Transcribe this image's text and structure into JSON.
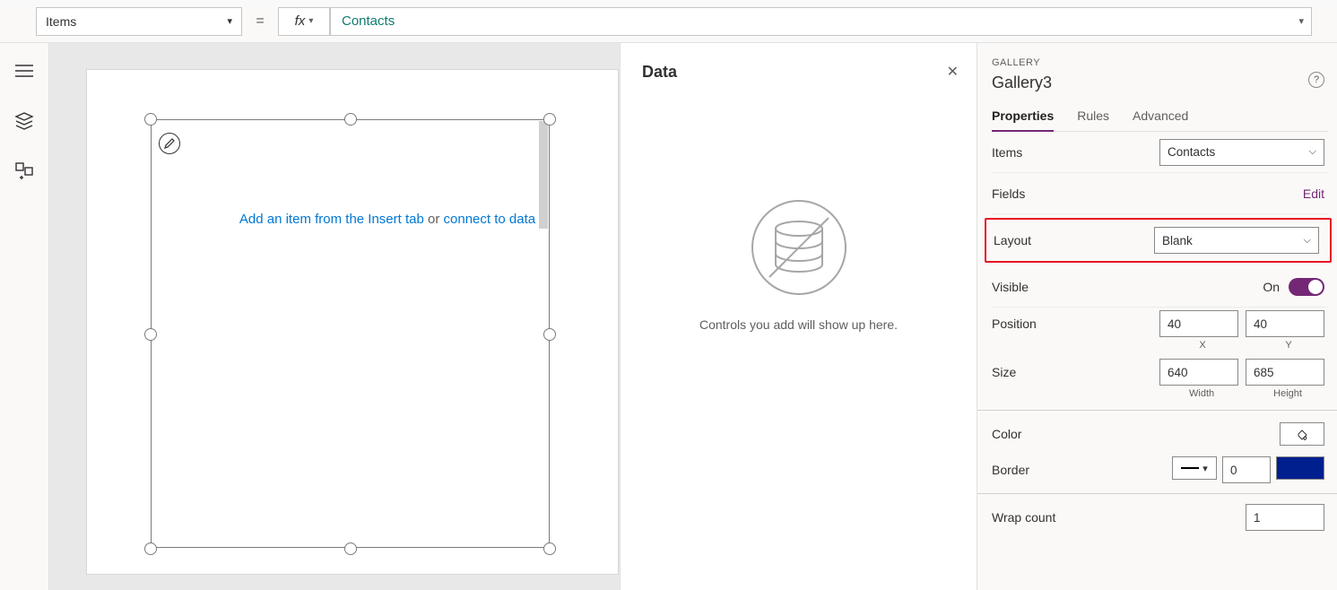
{
  "formula": {
    "property": "Items",
    "equals": "=",
    "fx": "fx",
    "value": "Contacts"
  },
  "canvas": {
    "msg_insert": "Add an item from the Insert tab",
    "msg_or": " or ",
    "msg_connect": "connect to data"
  },
  "dataPanel": {
    "title": "Data",
    "empty": "Controls you add will show up here."
  },
  "props": {
    "category": "GALLERY",
    "name": "Gallery3",
    "tabs": {
      "properties": "Properties",
      "rules": "Rules",
      "advanced": "Advanced"
    },
    "items": {
      "label": "Items",
      "value": "Contacts"
    },
    "fields": {
      "label": "Fields",
      "edit": "Edit"
    },
    "layout": {
      "label": "Layout",
      "value": "Blank"
    },
    "visible": {
      "label": "Visible",
      "state": "On"
    },
    "position": {
      "label": "Position",
      "x": "40",
      "y": "40",
      "xl": "X",
      "yl": "Y"
    },
    "size": {
      "label": "Size",
      "w": "640",
      "h": "685",
      "wl": "Width",
      "hl": "Height"
    },
    "color": {
      "label": "Color"
    },
    "border": {
      "label": "Border",
      "width": "0"
    },
    "wrap": {
      "label": "Wrap count",
      "value": "1"
    }
  }
}
